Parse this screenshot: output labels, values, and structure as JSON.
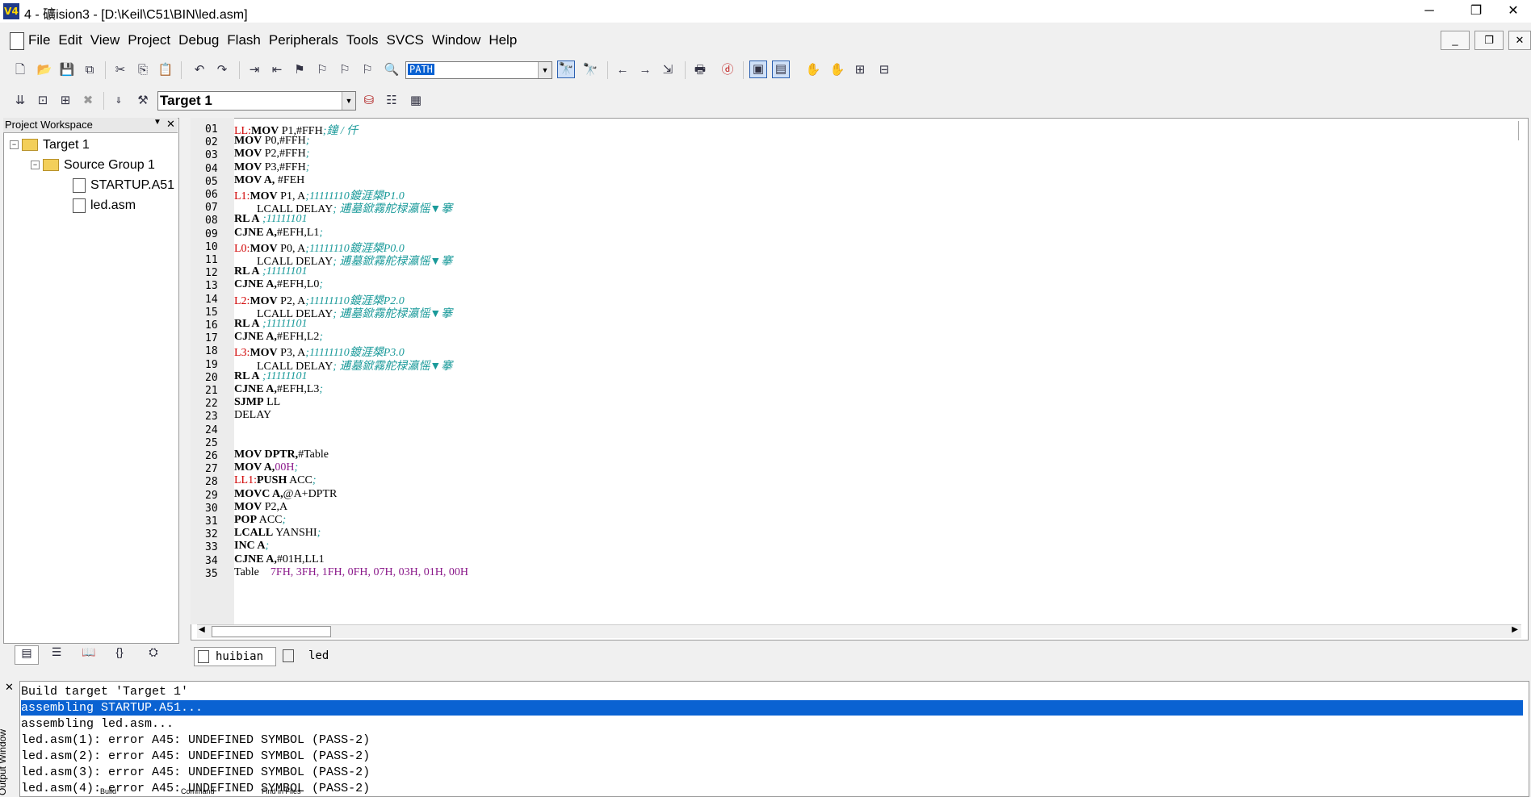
{
  "window": {
    "title": "4  - 礦ision3 - [D:\\Keil\\C51\\BIN\\led.asm]",
    "app_icon": "V4",
    "minimize": "─",
    "restore": "❐",
    "close": "✕"
  },
  "menu": {
    "items": [
      "File",
      "Edit",
      "View",
      "Project",
      "Debug",
      "Flash",
      "Peripherals",
      "Tools",
      "SVCS",
      "Window",
      "Help"
    ]
  },
  "toolbar": {
    "search_value": "PATH",
    "target": "Target 1"
  },
  "workspace": {
    "header": "Project Workspace",
    "tree": [
      {
        "label": "Target 1",
        "level": 0
      },
      {
        "label": "Source Group 1",
        "level": 1
      },
      {
        "label": "STARTUP.A51",
        "level": 2
      },
      {
        "label": "led.asm",
        "level": 2
      }
    ]
  },
  "editor": {
    "tabs": [
      "huibian",
      "led"
    ],
    "lines": [
      {
        "n": "01",
        "label": "LL:",
        "kw": "MOV",
        "op": " P1,#FFH",
        "cm": ";鐘 / 仟",
        "hex": ""
      },
      {
        "n": "02",
        "label": "",
        "kw": "MOV",
        "op": " P0,#FFH",
        "cm": ";",
        "hex": ""
      },
      {
        "n": "03",
        "label": "",
        "kw": "MOV",
        "op": " P2,#FFH",
        "cm": ";",
        "hex": ""
      },
      {
        "n": "04",
        "label": "",
        "kw": "MOV",
        "op": " P3,#FFH",
        "cm": ";",
        "hex": ""
      },
      {
        "n": "05",
        "label": "",
        "kw": "MOV A,",
        "op": " #FEH",
        "cm": "",
        "hex": ""
      },
      {
        "n": "06",
        "label": "L1:",
        "kw": "MOV",
        "op": " P1, A",
        "cm": ";11111110鍍涯槼P1.0",
        "hex": ""
      },
      {
        "n": "07",
        "label": "",
        "kw": "",
        "op": "        LCALL DELAY",
        "cm": "; 逋墓鍁霧舵椂瀛愮▼搴",
        "hex": ""
      },
      {
        "n": "08",
        "label": "",
        "kw": "RL A",
        "op": " ",
        "cm": ";11111101",
        "hex": ""
      },
      {
        "n": "09",
        "label": "",
        "kw": "CJNE A,",
        "op": "#EFH,L1",
        "cm": ";",
        "hex": ""
      },
      {
        "n": "10",
        "label": "L0:",
        "kw": "MOV",
        "op": " P0, A",
        "cm": ";11111110鍍涯槼P0.0",
        "hex": ""
      },
      {
        "n": "11",
        "label": "",
        "kw": "",
        "op": "        LCALL DELAY",
        "cm": "; 逋墓鍁霧舵椂瀛愮▼搴",
        "hex": ""
      },
      {
        "n": "12",
        "label": "",
        "kw": "RL A",
        "op": " ",
        "cm": ";11111101",
        "hex": ""
      },
      {
        "n": "13",
        "label": "",
        "kw": "CJNE A,",
        "op": "#EFH,L0",
        "cm": ";",
        "hex": ""
      },
      {
        "n": "14",
        "label": "L2:",
        "kw": "MOV",
        "op": " P2, A",
        "cm": ";11111110鍍涯槼P2.0",
        "hex": ""
      },
      {
        "n": "15",
        "label": "",
        "kw": "",
        "op": "        LCALL DELAY",
        "cm": "; 逋墓鍁霧舵椂瀛愮▼搴",
        "hex": ""
      },
      {
        "n": "16",
        "label": "",
        "kw": "RL A",
        "op": " ",
        "cm": ";11111101",
        "hex": ""
      },
      {
        "n": "17",
        "label": "",
        "kw": "CJNE A,",
        "op": "#EFH,L2",
        "cm": ";",
        "hex": ""
      },
      {
        "n": "18",
        "label": "L3:",
        "kw": "MOV",
        "op": " P3, A",
        "cm": ";11111110鍍涯槼P3.0",
        "hex": ""
      },
      {
        "n": "19",
        "label": "",
        "kw": "",
        "op": "        LCALL DELAY",
        "cm": "; 逋墓鍁霧舵椂瀛愮▼搴",
        "hex": ""
      },
      {
        "n": "20",
        "label": "",
        "kw": "RL A",
        "op": " ",
        "cm": ";11111101",
        "hex": ""
      },
      {
        "n": "21",
        "label": "",
        "kw": "CJNE A,",
        "op": "#EFH,L3",
        "cm": ";",
        "hex": ""
      },
      {
        "n": "22",
        "label": "",
        "kw": "SJMP",
        "op": " LL",
        "cm": "",
        "hex": ""
      },
      {
        "n": "23",
        "label": "",
        "kw": "",
        "op": "DELAY",
        "cm": "",
        "hex": ""
      },
      {
        "n": "24",
        "label": "",
        "kw": "",
        "op": "",
        "cm": "",
        "hex": ""
      },
      {
        "n": "25",
        "label": "",
        "kw": "",
        "op": "",
        "cm": "",
        "hex": ""
      },
      {
        "n": "26",
        "label": "",
        "kw": "MOV DPTR,",
        "op": "#Table",
        "cm": "",
        "hex": ""
      },
      {
        "n": "27",
        "label": "",
        "kw": "MOV A,",
        "op": "",
        "cm": ";",
        "hex": "00H"
      },
      {
        "n": "28",
        "label": "LL1:",
        "kw": "PUSH",
        "op": " ACC",
        "cm": ";",
        "hex": ""
      },
      {
        "n": "29",
        "label": "",
        "kw": "MOVC A,",
        "op": "@A+DPTR",
        "cm": "",
        "hex": ""
      },
      {
        "n": "30",
        "label": "",
        "kw": "MOV",
        "op": " P2,A",
        "cm": "",
        "hex": ""
      },
      {
        "n": "31",
        "label": "",
        "kw": "POP",
        "op": " ACC",
        "cm": ";",
        "hex": ""
      },
      {
        "n": "32",
        "label": "",
        "kw": "LCALL",
        "op": " YANSHI",
        "cm": ";",
        "hex": ""
      },
      {
        "n": "33",
        "label": "",
        "kw": "INC A",
        "op": "",
        "cm": ";",
        "hex": ""
      },
      {
        "n": "34",
        "label": "",
        "kw": "CJNE A,",
        "op": "#01H,LL1",
        "cm": "",
        "hex": ""
      },
      {
        "n": "35",
        "label": "",
        "kw": "",
        "op": "Table    ",
        "cm": "",
        "hex": "7FH, 3FH, 1FH, 0FH, 07H, 03H, 01H, 00H"
      }
    ]
  },
  "output": {
    "side_label": "Output Window",
    "lines": [
      "Build target 'Target 1'",
      "assembling STARTUP.A51...",
      "assembling led.asm...",
      "led.asm(1): error A45: UNDEFINED SYMBOL (PASS-2)",
      "led.asm(2): error A45: UNDEFINED SYMBOL (PASS-2)",
      "led.asm(3): error A45: UNDEFINED SYMBOL (PASS-2)",
      "led.asm(4): error A45: UNDEFINED SYMBOL (PASS-2)"
    ],
    "selected_index": 1,
    "tabs": [
      "Build",
      "Command",
      "Find in Files"
    ]
  }
}
